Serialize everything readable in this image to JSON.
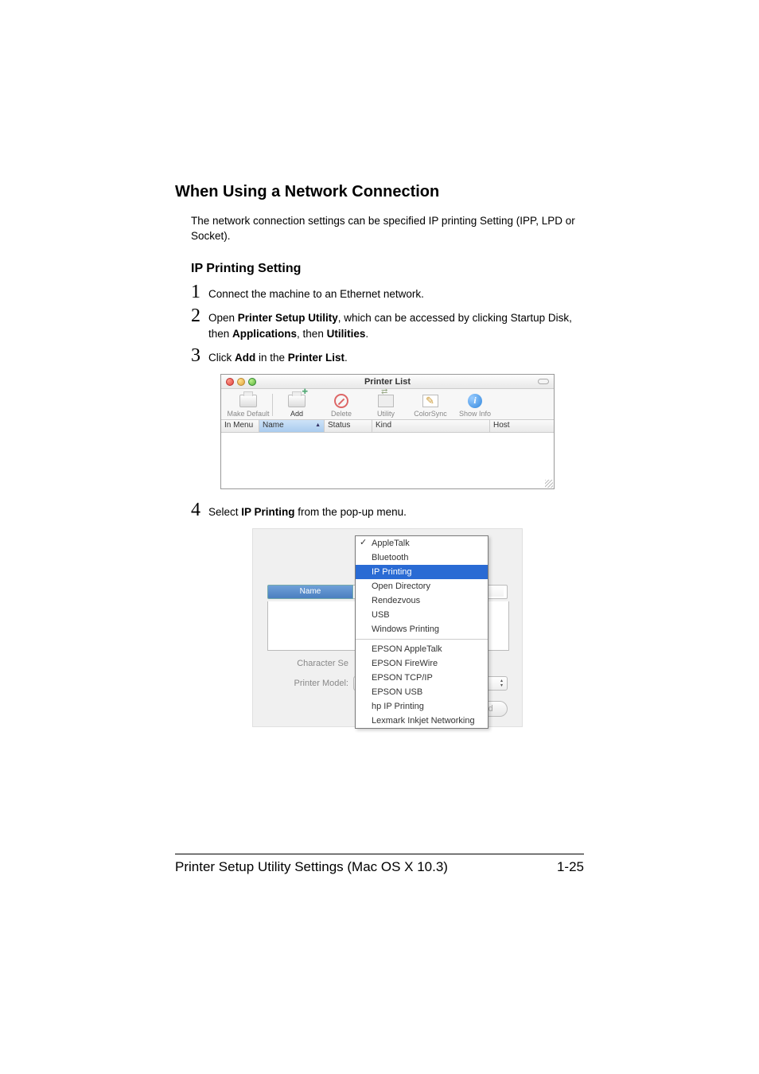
{
  "headings": {
    "h2": "When Using a Network Connection",
    "intro": "The network connection settings can be specified IP printing Setting (IPP, LPD or Socket).",
    "h3": "IP Printing Setting"
  },
  "steps": {
    "s1": {
      "num": "1",
      "text": "Connect the machine to an Ethernet network."
    },
    "s2": {
      "num": "2",
      "pre": "Open ",
      "b1": "Printer Setup Utility",
      "mid1": ", which can be accessed by clicking Startup Disk, then ",
      "b2": "Applications",
      "mid2": ", then ",
      "b3": "Utilities",
      "post": "."
    },
    "s3": {
      "num": "3",
      "pre": "Click ",
      "b1": "Add",
      "mid": " in the ",
      "b2": "Printer List",
      "post": "."
    },
    "s4": {
      "num": "4",
      "pre": "Select ",
      "b1": "IP Printing",
      "post": " from the pop-up menu."
    }
  },
  "printerList": {
    "title": "Printer List",
    "toolbar": {
      "makeDefault": "Make Default",
      "add": "Add",
      "delete": "Delete",
      "utility": "Utility",
      "colorsync": "ColorSync",
      "showInfo": "Show Info"
    },
    "cols": {
      "c1": "In Menu",
      "c2": "Name",
      "c3": "Status",
      "c4": "Kind",
      "c5": "Host"
    }
  },
  "popup": {
    "labels": {
      "name": "Name",
      "charset": "Character Se",
      "printerModel": "Printer Model:",
      "add": "Add"
    },
    "menu": {
      "appleTalk": "AppleTalk",
      "bluetooth": "Bluetooth",
      "ipPrinting": "IP Printing",
      "openDirectory": "Open Directory",
      "rendezvous": "Rendezvous",
      "usb": "USB",
      "windowsPrinting": "Windows Printing",
      "epsonAppleTalk": "EPSON AppleTalk",
      "epsonFireWire": "EPSON FireWire",
      "epsonTcpIp": "EPSON TCP/IP",
      "epsonUsb": "EPSON USB",
      "hpIpPrinting": "hp IP Printing",
      "lexmark": "Lexmark Inkjet Networking"
    }
  },
  "footer": {
    "left": "Printer Setup Utility Settings (Mac OS X 10.3)",
    "right": "1-25"
  }
}
